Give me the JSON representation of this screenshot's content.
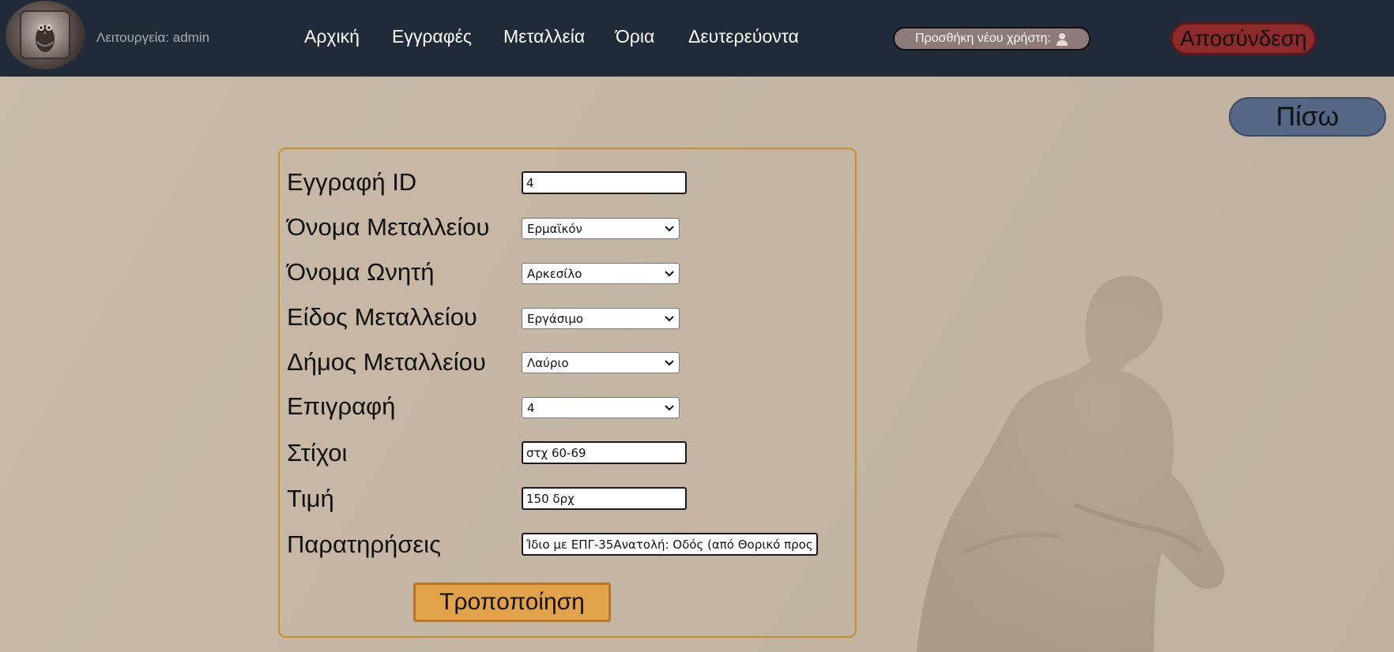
{
  "header": {
    "mode_label": "Λειτουργεία: admin",
    "nav": [
      "Αρχική",
      "Εγγραφές",
      "Μεταλλεία",
      "Όρια",
      "Δευτερεύοντα"
    ],
    "add_user_label": "Προσθήκη νέου χρήστη:",
    "logout_label": "Αποσύνδεση"
  },
  "back_label": "Πίσω",
  "form": {
    "record_id": {
      "label": "Εγγραφή ID",
      "value": "4"
    },
    "mine_name": {
      "label": "Όνομα Μεταλλείου",
      "value": "Ερμαϊκόν"
    },
    "buyer_name": {
      "label": "Όνομα Ωνητή",
      "value": "Αρκεσίλο"
    },
    "mine_type": {
      "label": "Είδος Μεταλλείου",
      "value": "Εργάσιμο"
    },
    "municipality": {
      "label": "Δήμος Μεταλλείου",
      "value": "Λαύριο"
    },
    "inscription": {
      "label": "Επιγραφή",
      "value": "4"
    },
    "verses": {
      "label": "Στίχοι",
      "value": "στχ 60-69"
    },
    "price": {
      "label": "Τιμή",
      "value": "150 δρχ"
    },
    "notes": {
      "label": "Παρατηρήσεις",
      "value": "Ίδιο με ΕΠΓ-35Ανατολή: Οδός (από Θορικό προς"
    },
    "submit_label": "Τροποποίηση"
  },
  "colors": {
    "topbar": "#212a38",
    "background": "#c4b6a3",
    "logout": "#8e2a2a",
    "back": "#546785",
    "submit": "#e2a24a",
    "panel_border": "#c98f2a"
  },
  "icons": {
    "logo": "owl-coin-logo",
    "add_user": "user-icon",
    "select_arrow": "chevron-down-icon",
    "statue": "boxer-statue"
  }
}
